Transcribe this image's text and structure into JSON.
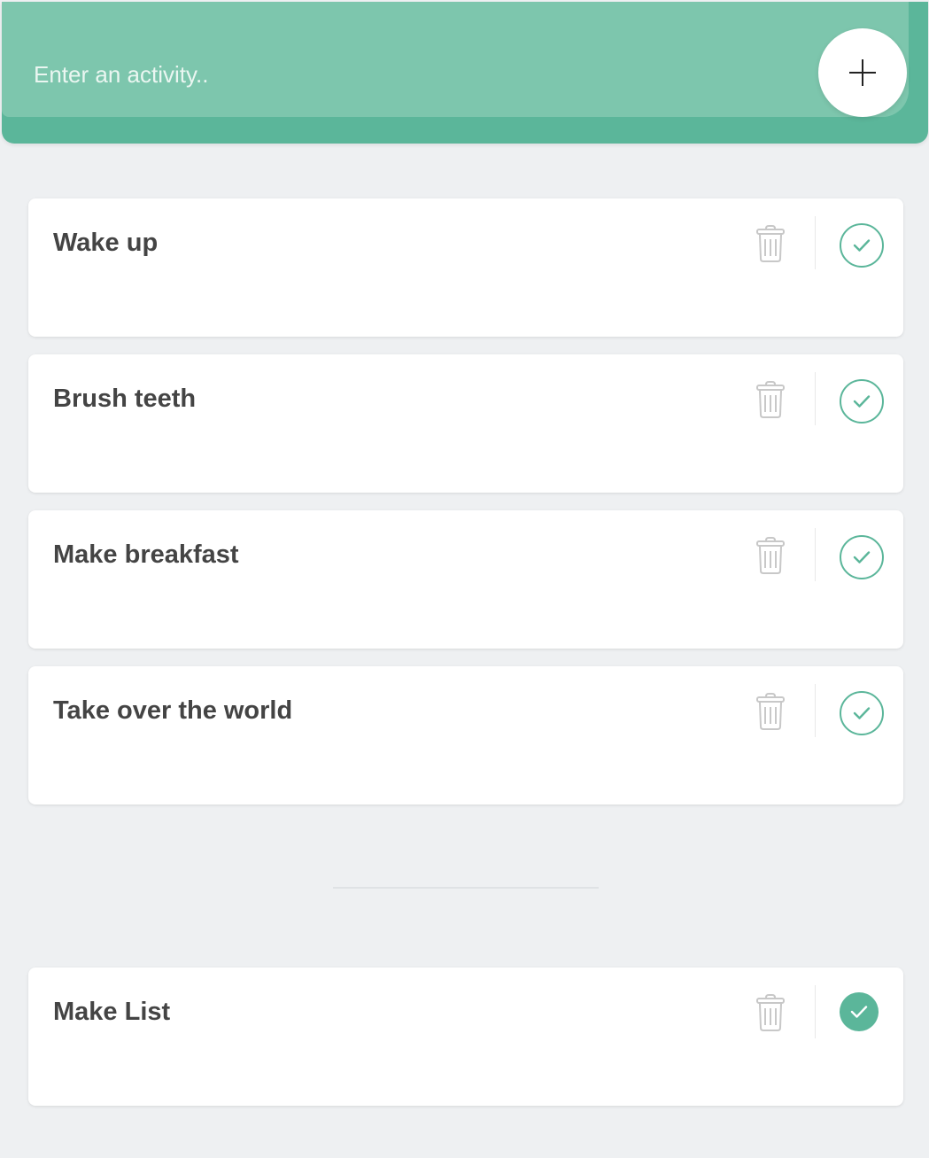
{
  "header": {
    "input_placeholder": "Enter an activity..",
    "input_value": "",
    "add_button_icon": "plus-icon"
  },
  "todo": [
    {
      "text": "Wake up"
    },
    {
      "text": "Brush teeth"
    },
    {
      "text": "Make breakfast"
    },
    {
      "text": "Take over the world"
    }
  ],
  "completed": [
    {
      "text": "Make List"
    }
  ],
  "icons": {
    "delete": "trash-icon",
    "complete": "check-icon"
  },
  "colors": {
    "accent": "#5bb69a",
    "header_light": "#7dc6ad",
    "background": "#eef0f2",
    "text": "#444444",
    "icon_muted": "#c8c8c8"
  }
}
